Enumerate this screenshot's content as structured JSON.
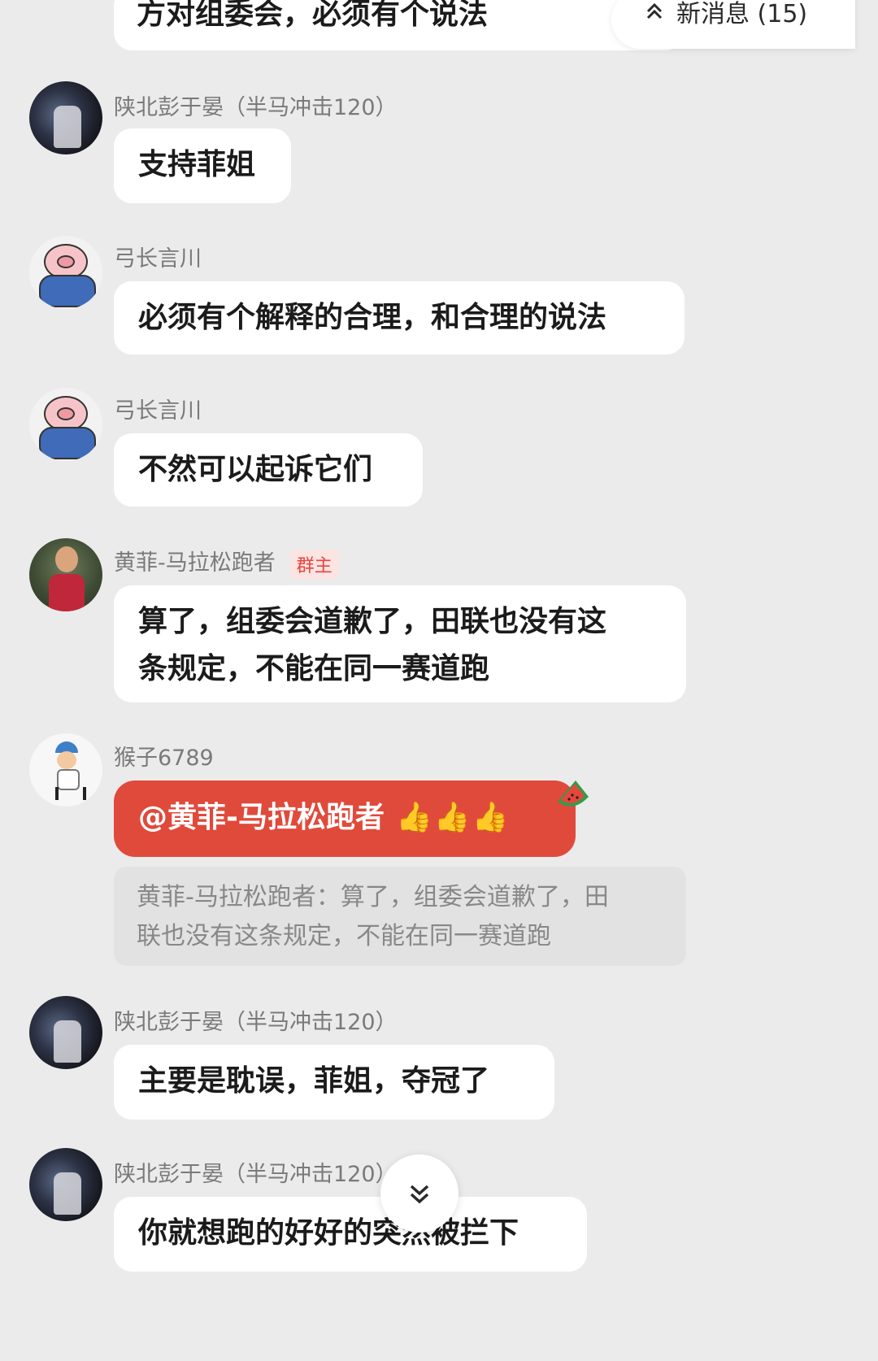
{
  "header": {
    "partial_message": "方对组委会，必须有个说法",
    "new_messages_label": "新消息 (15)"
  },
  "messages": [
    {
      "sender": "陕北彭于晏（半马冲击120）",
      "text": "支持菲姐"
    },
    {
      "sender": "弓长言川",
      "text": "必须有个解释的合理，和合理的说法"
    },
    {
      "sender": "弓长言川",
      "text": "不然可以起诉它们"
    },
    {
      "sender": "黄菲-马拉松跑者",
      "badge": "群主",
      "text_lines": [
        "算了，组委会道歉了，田联也没有这",
        "条规定，不能在同一赛道跑"
      ]
    },
    {
      "sender": "猴子6789",
      "text": "@黄菲-马拉松跑者",
      "emoji": "👍👍👍",
      "quote_lines": [
        "黄菲-马拉松跑者：算了，组委会道歉了，田",
        "联也没有这条规定，不能在同一赛道跑"
      ]
    },
    {
      "sender": "陕北彭于晏（半马冲击120）",
      "text": "主要是耽误，菲姐，夺冠了"
    },
    {
      "sender": "陕北彭于晏（半马冲击120）",
      "text": "你就想跑的好好的突然被拦下"
    }
  ],
  "icons": {
    "new_messages": "double-chevron-up-icon",
    "scroll_down": "double-chevron-down-icon"
  }
}
